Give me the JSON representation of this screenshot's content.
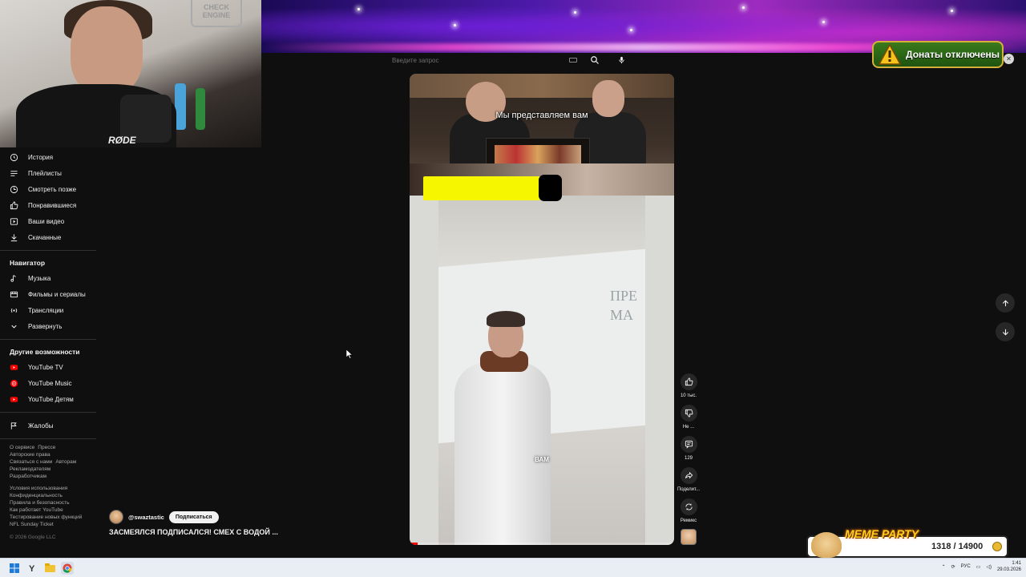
{
  "search": {
    "placeholder": "Введите запрос"
  },
  "donate": {
    "text": "Донаты отключены"
  },
  "sidebar": {
    "you_items": [
      {
        "label": "История",
        "icon": "history-icon"
      },
      {
        "label": "Плейлисты",
        "icon": "playlists-icon"
      },
      {
        "label": "Смотреть позже",
        "icon": "watch-later-icon"
      },
      {
        "label": "Понравившиеся",
        "icon": "thumb-up-icon"
      },
      {
        "label": "Ваши видео",
        "icon": "your-videos-icon"
      },
      {
        "label": "Скачанные",
        "icon": "download-icon"
      }
    ],
    "navigator_heading": "Навигатор",
    "navigator_items": [
      {
        "label": "Музыка",
        "icon": "music-icon"
      },
      {
        "label": "Фильмы и сериалы",
        "icon": "movies-icon"
      },
      {
        "label": "Трансляции",
        "icon": "live-icon"
      },
      {
        "label": "Развернуть",
        "icon": "chevron-down-icon"
      }
    ],
    "more_heading": "Другие возможности",
    "more_items": [
      {
        "label": "YouTube TV",
        "icon": "youtube-tv-icon"
      },
      {
        "label": "YouTube Music",
        "icon": "youtube-music-icon"
      },
      {
        "label": "YouTube Детям",
        "icon": "youtube-kids-icon"
      }
    ],
    "report": {
      "label": "Жалобы",
      "icon": "flag-icon"
    },
    "footer_links_1": [
      "О сервисе",
      "Прессе",
      "Авторские права",
      "Связаться с нами",
      "Авторам",
      "Рекламодателям",
      "Разработчикам"
    ],
    "footer_links_2": [
      "Условия использования",
      "Конфиденциальность",
      "Правила и безопасность",
      "Как работает YouTube",
      "Тестирование новых функций",
      "NFL Sunday Ticket"
    ],
    "copyright": "© 2026 Google LLC"
  },
  "video": {
    "caption_top": "Мы представляем вам",
    "subtitle_word": "ВАМ",
    "whiteboard_text": [
      "ПРЕ",
      "МА"
    ],
    "progress_fraction": 0.03
  },
  "channel": {
    "handle": "@swaztastic",
    "subscribe_label": "Подписаться"
  },
  "title": "ЗАСМЕЯЛСЯ ПОДПИСАЛСЯ! СМЕХ С ВОДОЙ ...",
  "actions": {
    "like": "10 тыс.",
    "dislike": "Не ...",
    "comments": "129",
    "share": "Поделит...",
    "remix": "Ремикс"
  },
  "overlay": {
    "meme_title": "MEME PARTY",
    "meme_counter": "1318 / 14900"
  },
  "webcam": {
    "mic_brand": "RØDE",
    "sign": "CHECK ENGINE"
  },
  "taskbar": {
    "lang": "РУС",
    "time": "1:41",
    "date": "29.03.2026"
  },
  "colors": {
    "accent_red": "#ff0000",
    "yellow": "#f6f600",
    "donate_green": "#2f6a16"
  }
}
